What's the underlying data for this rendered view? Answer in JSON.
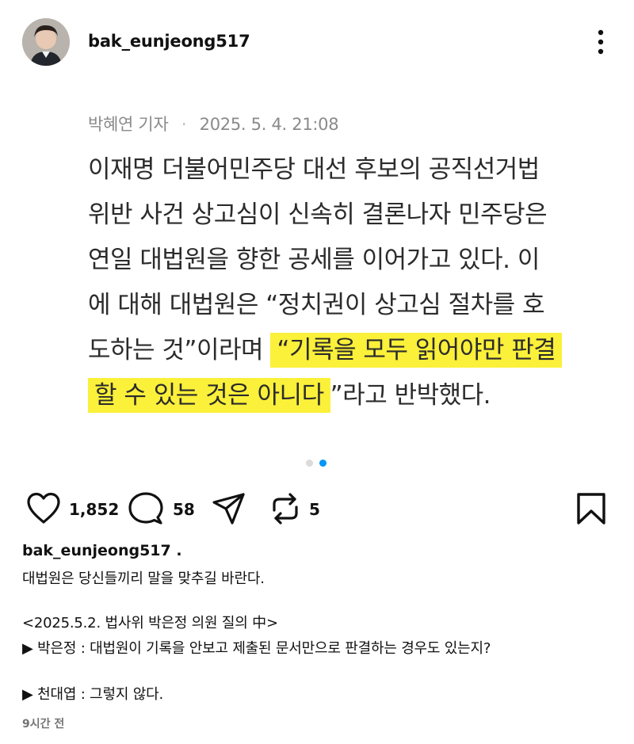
{
  "post": {
    "author": "bak_eunjeong517",
    "byline_name": "박혜연 기자",
    "byline_sep": "·",
    "byline_date": "2025. 5. 4. 21:08",
    "article": {
      "lines": [
        {
          "plain": "이재명 더불어민주당 대선 후보의 공직선거법"
        },
        {
          "plain": "위반 사건 상고심이 신속히 결론나자 민주당은"
        },
        {
          "plain": "연일 대법원을 향한 공세를 이어가고 있다. 이"
        },
        {
          "plain": "에 대해 대법원은 “정치권이 상고심 절차를 호"
        },
        {
          "plain": "도하는 것”이라며 ",
          "highlight": "“기록을 모두 읽어야만 판결"
        },
        {
          "highlight": "할 수 있는 것은 아니다",
          "plain_after": "”라고 반박했다."
        }
      ]
    },
    "carousel": {
      "total": 2,
      "active_index": 1
    }
  },
  "actions": {
    "likes": "1,852",
    "comments": "58",
    "reposts": "5",
    "icons": [
      "heart-icon",
      "comment-icon",
      "share-icon",
      "repost-icon",
      "bookmark-icon"
    ]
  },
  "caption": {
    "user": "bak_eunjeong517 .",
    "lines": [
      "대법원은 당신들끼리 말을 맞추길 바란다.",
      "",
      "<2025.5.2. 법사위 박은정 의원 질의 中>",
      "▶ 박은정 : 대법원이 기록을 안보고 제출된 문서만으로 판결하는 경우도 있는지?",
      "",
      "▶ 천대엽 : 그렇지 않다."
    ]
  },
  "timestamp": "9시간 전",
  "colors": {
    "highlight": "#fbf03a",
    "dot_active": "#0095f6",
    "dot_inactive": "#dbdbdb"
  }
}
